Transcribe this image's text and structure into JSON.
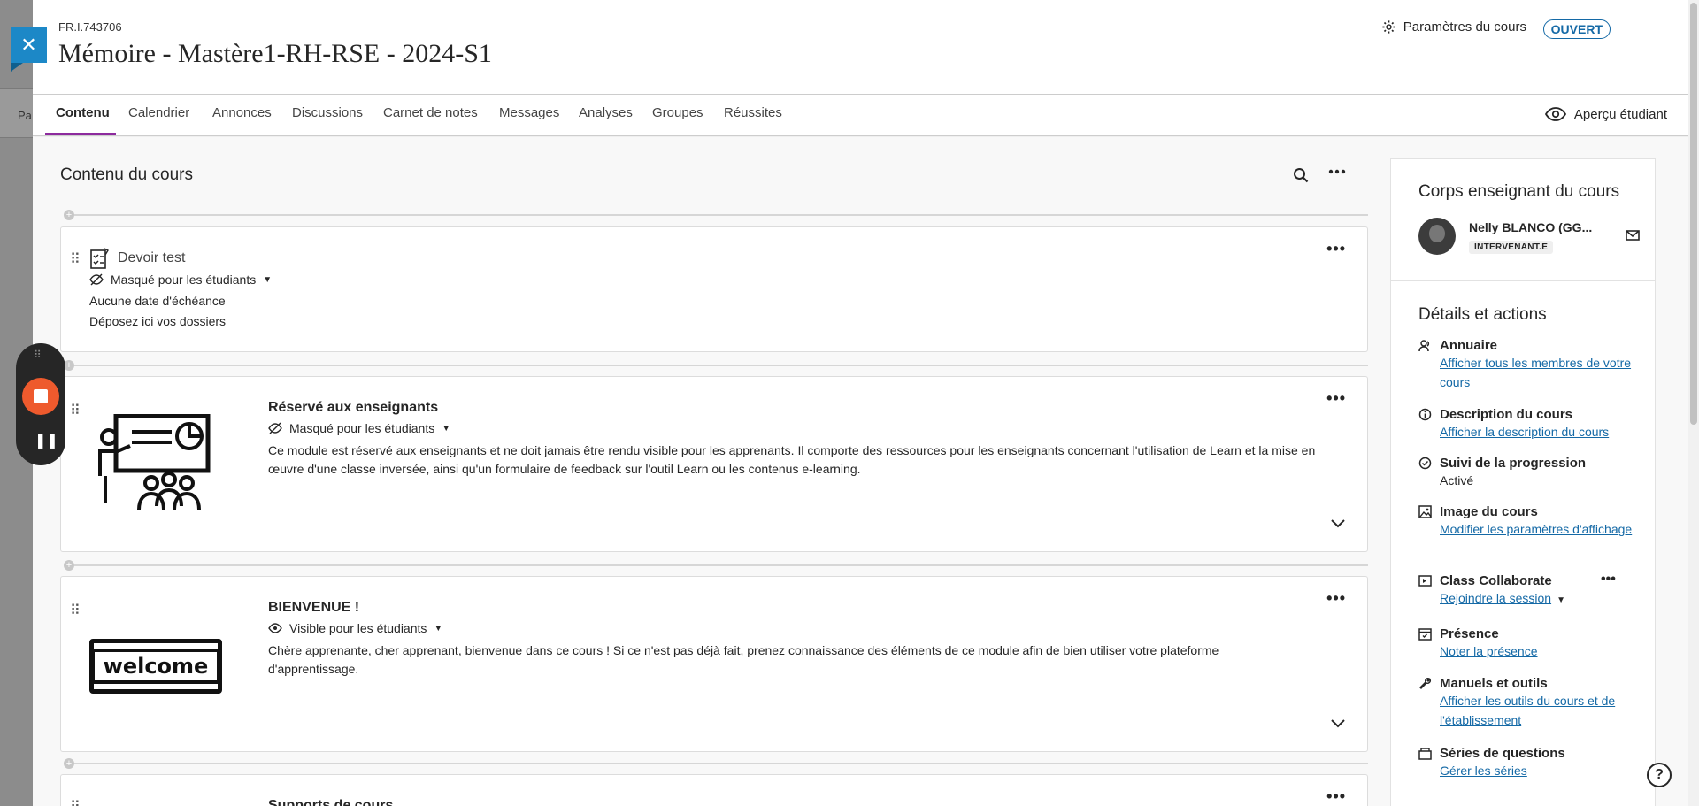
{
  "background": {
    "side_text": "Pa"
  },
  "header": {
    "course_id": "FR.I.743706",
    "course_title": "Mémoire - Mastère1-RH-RSE - 2024-S1",
    "settings_label": "Paramètres du cours",
    "status_badge": "OUVERT"
  },
  "tabs": [
    "Contenu",
    "Calendrier",
    "Annonces",
    "Discussions",
    "Carnet de notes",
    "Messages",
    "Analyses",
    "Groupes",
    "Réussites"
  ],
  "student_preview_label": "Aperçu étudiant",
  "content": {
    "title": "Contenu du cours",
    "items": [
      {
        "title": "Devoir test",
        "visibility": "Masqué pour les étudiants",
        "due": "Aucune date d'échéance",
        "dropzone": "Déposez ici vos dossiers"
      },
      {
        "title": "Réservé aux enseignants",
        "visibility": "Masqué pour les étudiants",
        "description": "Ce module est réservé aux enseignants et ne doit jamais être rendu visible pour les apprenants. Il comporte des ressources pour les enseignants concernant l'utilisation de Learn et la mise en œuvre d'une classe inversée, ainsi qu'un formulaire de feedback sur l'outil Learn ou les contenus e-learning."
      },
      {
        "title": "BIENVENUE !",
        "visibility": "Visible pour les étudiants",
        "image_text": "welcome",
        "description": "Chère apprenante, cher apprenant, bienvenue dans ce cours ! Si ce n'est pas déjà fait, prenez connaissance des éléments de ce module afin de bien utiliser votre plateforme d'apprentissage."
      },
      {
        "title": "Supports de cours"
      }
    ]
  },
  "sidebar": {
    "instructors_title": "Corps enseignant du cours",
    "instructor_name": "Nelly BLANCO (GG...",
    "instructor_role": "INTERVENANT.E",
    "details_title": "Détails et actions",
    "actions": [
      {
        "icon": "people-icon",
        "title": "Annuaire",
        "link": "Afficher tous les membres de votre cours"
      },
      {
        "icon": "info-icon",
        "title": "Description du cours",
        "link": "Afficher la description du cours"
      },
      {
        "icon": "check-circle-icon",
        "title": "Suivi de la progression",
        "text": "Activé"
      },
      {
        "icon": "image-icon",
        "title": "Image du cours",
        "link": "Modifier les paramètres d'affichage"
      },
      {
        "icon": "video-icon",
        "title": "Class Collaborate",
        "link": "Rejoindre la session"
      },
      {
        "icon": "attendance-icon",
        "title": "Présence",
        "link": "Noter la présence"
      },
      {
        "icon": "wrench-icon",
        "title": "Manuels et outils",
        "link": "Afficher les outils du cours et de l'établissement"
      },
      {
        "icon": "question-bank-icon",
        "title": "Séries de questions",
        "link": "Gérer les séries"
      }
    ]
  },
  "colors": {
    "accent": "#8d2b9e",
    "link": "#1469a6",
    "close": "#1c88c7",
    "record": "#ee5a2d"
  }
}
